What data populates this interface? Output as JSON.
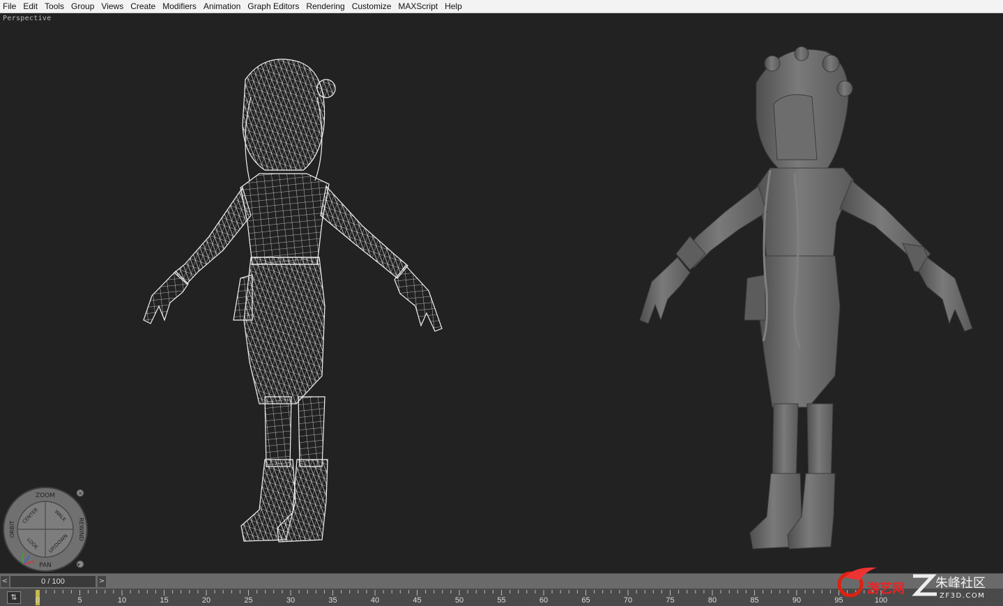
{
  "menu": [
    "File",
    "Edit",
    "Tools",
    "Group",
    "Views",
    "Create",
    "Modifiers",
    "Animation",
    "Graph Editors",
    "Rendering",
    "Customize",
    "MAXScript",
    "Help"
  ],
  "viewport": {
    "label": "Perspective"
  },
  "steering_wheel": {
    "zoom": "ZOOM",
    "orbit": "ORBIT",
    "center": "CENTER",
    "walk": "WALK",
    "rewind": "REWIND",
    "look": "LOOK",
    "updown": "UP/DOWN",
    "pan": "PAN"
  },
  "timeline": {
    "frame_display": "0 / 100",
    "prev_label": "<",
    "next_label": ">",
    "current_frame": 0,
    "ticks": [
      "0",
      "5",
      "10",
      "15",
      "20",
      "25",
      "30",
      "35",
      "40",
      "45",
      "50",
      "55",
      "60",
      "65",
      "70",
      "75",
      "80",
      "85",
      "90",
      "95",
      "100"
    ]
  },
  "watermark": {
    "cn1": "游艺网",
    "cn2": "朱峰社区",
    "site": "ZF3D.COM"
  },
  "colors": {
    "menubar": "#f3f3f3",
    "viewport_bg": "#222222",
    "wireframe": "#f2f2f2",
    "shaded": "#6b6b6b",
    "marker": "#d7c84a"
  }
}
